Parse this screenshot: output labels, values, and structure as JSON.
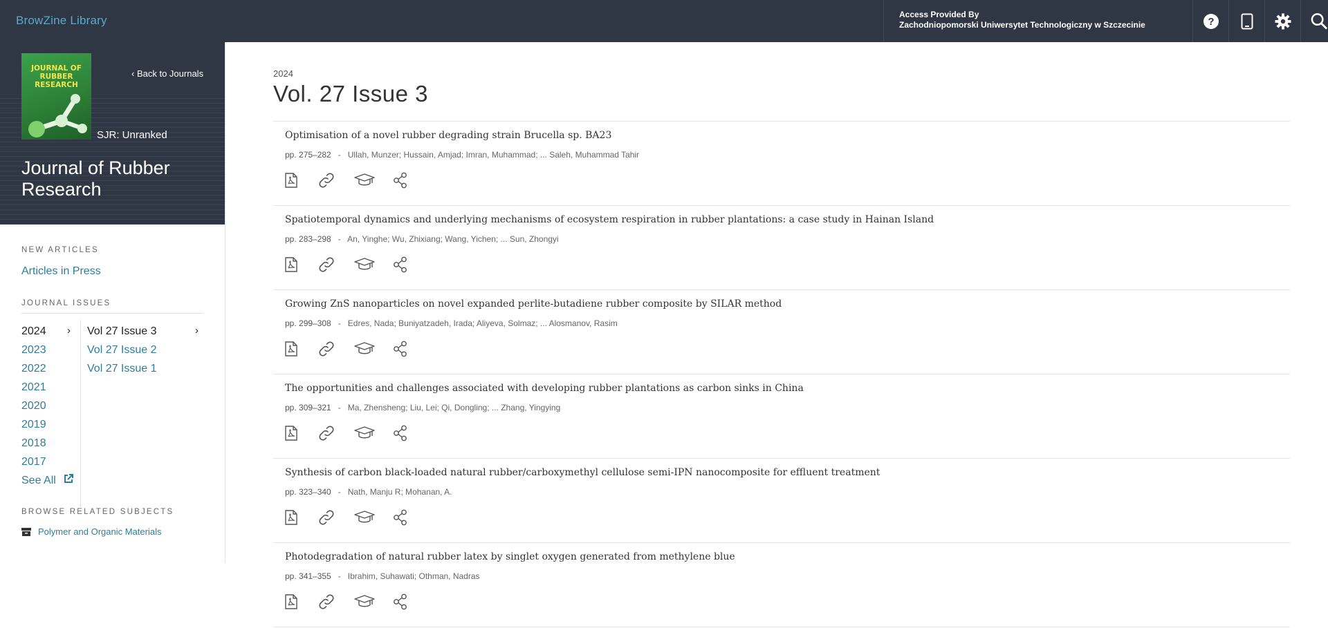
{
  "topbar": {
    "brand": "BrowZine Library",
    "access_line1": "Access Provided By",
    "access_line2": "Zachodniopomorski Uniwersytet Technologiczny w Szczecinie",
    "icons": [
      "help-icon",
      "device-icon",
      "settings-icon",
      "search-icon"
    ],
    "bg_color": "#2f3644",
    "brand_color": "#5ea9c6"
  },
  "sidebar": {
    "cover_title": "JOURNAL OF RUBBER RESEARCH",
    "back_label": "Back to Journals",
    "sjr": "SJR: Unranked",
    "journal_title": "Journal of Rubber Research",
    "new_articles_heading": "NEW ARTICLES",
    "articles_in_press": "Articles in Press",
    "issues_heading": "JOURNAL ISSUES",
    "years": [
      "2024",
      "2023",
      "2022",
      "2021",
      "2020",
      "2019",
      "2018",
      "2017"
    ],
    "active_year": "2024",
    "volumes": [
      "Vol 27 Issue 3",
      "Vol 27 Issue 2",
      "Vol 27 Issue 1"
    ],
    "active_volume": "Vol 27 Issue 3",
    "see_all": "See All",
    "subjects_heading": "BROWSE RELATED SUBJECTS",
    "subject": "Polymer and Organic Materials",
    "link_color": "#2e7d9a"
  },
  "main": {
    "year": "2024",
    "issue_title": "Vol. 27 Issue 3",
    "articles": [
      {
        "title": "Optimisation of a novel rubber degrading strain Brucella sp. BA23",
        "pages": "pp. 275–282",
        "authors": "Ullah, Munzer; Hussain, Amjad; Imran, Muhammad; ... Saleh, Muhammad Tahir"
      },
      {
        "title": "Spatiotemporal dynamics and underlying mechanisms of ecosystem respiration in rubber plantations: a case study in Hainan Island",
        "pages": "pp. 283–298",
        "authors": "An, Yinghe; Wu, Zhixiang; Wang, Yichen; ... Sun, Zhongyi"
      },
      {
        "title": "Growing ZnS nanoparticles on novel expanded perlite-butadiene rubber composite by SILAR method",
        "pages": "pp. 299–308",
        "authors": "Edres, Nada; Buniyatzadeh, Irada; Aliyeva, Solmaz; ... Alosmanov, Rasim"
      },
      {
        "title": "The opportunities and challenges associated with developing rubber plantations as carbon sinks in China",
        "pages": "pp. 309–321",
        "authors": "Ma, Zhensheng; Liu, Lei; Qi, Dongling; ... Zhang, Yingying"
      },
      {
        "title": "Synthesis of carbon black-loaded natural rubber/carboxymethyl cellulose semi-IPN nanocomposite for effluent treatment",
        "pages": "pp. 323–340",
        "authors": "Nath, Manju R; Mohanan, A."
      },
      {
        "title": "Photodegradation of natural rubber latex by singlet oxygen generated from methylene blue",
        "pages": "pp. 341–355",
        "authors": "Ibrahim, Suhawati; Othman, Nadras"
      }
    ],
    "article_icons": [
      "pdf-icon",
      "link-icon",
      "cap-icon",
      "share-icon"
    ]
  }
}
